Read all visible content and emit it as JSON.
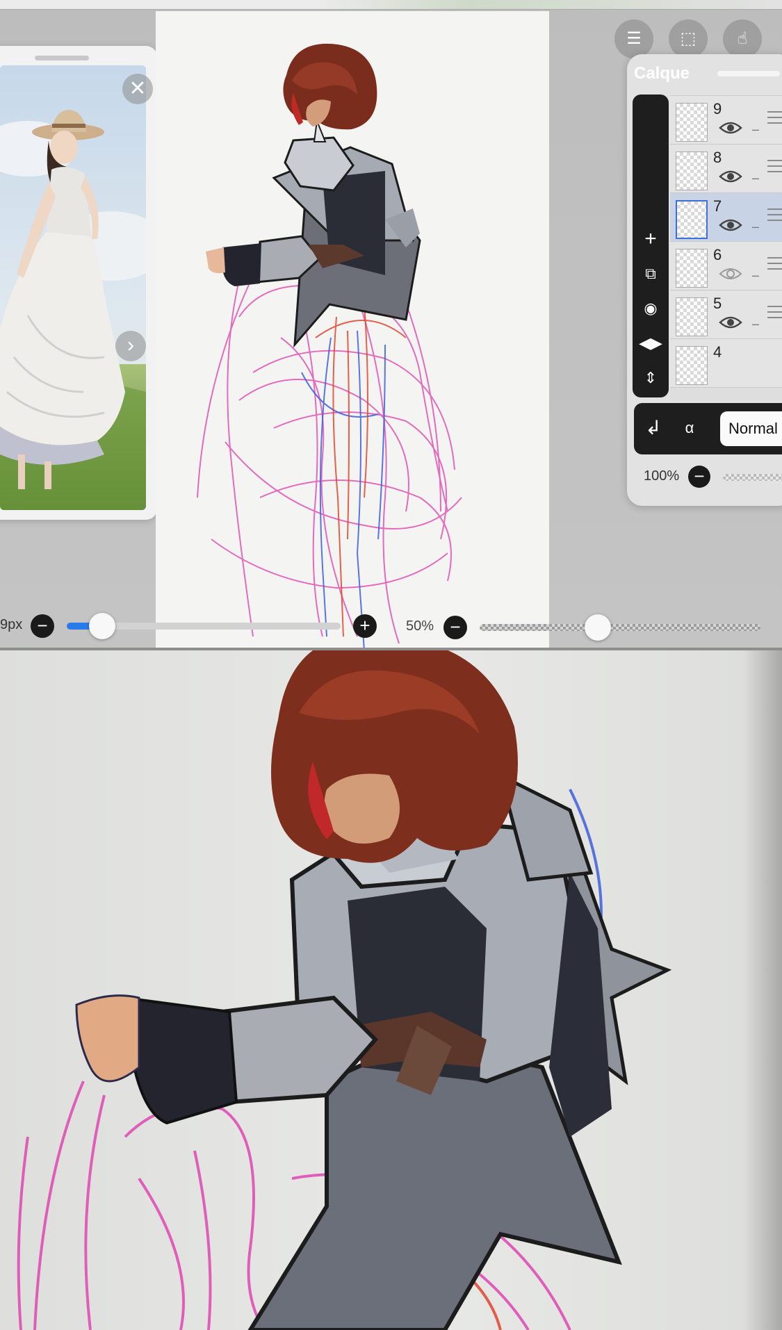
{
  "layers_panel": {
    "title": "Calque",
    "layers": [
      {
        "number": "9",
        "visible": true,
        "selected": false
      },
      {
        "number": "8",
        "visible": true,
        "selected": false
      },
      {
        "number": "7",
        "visible": true,
        "selected": true
      },
      {
        "number": "6",
        "visible": false,
        "selected": false
      },
      {
        "number": "5",
        "visible": true,
        "selected": false
      },
      {
        "number": "4",
        "visible": true,
        "selected": false
      }
    ],
    "tools": [
      "add-layer-icon",
      "duplicate-layer-icon",
      "camera-icon",
      "flip-horizontal-icon",
      "flip-vertical-icon"
    ],
    "blend_mode": "Normal",
    "opacity": "100%"
  },
  "brush": {
    "size": "9px",
    "size_fraction": 0.13,
    "opacity": "50%",
    "opacity_fraction": 0.42
  },
  "icons": {
    "close": "✕",
    "next": "›",
    "plus": "+",
    "minus": "−"
  },
  "colors": {
    "accent": "#2a7bea",
    "selected_layer": "#c9d3e6",
    "panel_dark": "#1e1e1e"
  }
}
